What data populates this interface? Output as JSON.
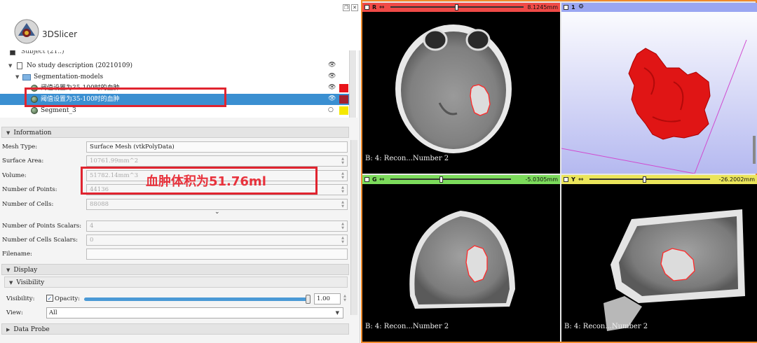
{
  "app": {
    "name": "3DSlicer"
  },
  "tree": {
    "cut_top_label": "Subject (21..)",
    "study": "No study description (20210109)",
    "folder": "Segmentation-models",
    "items": [
      {
        "label": "阈值设置为35-100时的血肿",
        "color": "#e8141a"
      },
      {
        "label": "阈值设置为35-100时的血肿",
        "color": "#a3222f",
        "selected": true
      },
      {
        "label": "Segment_3",
        "color": "#f5e800"
      }
    ]
  },
  "sections": {
    "information": "Information",
    "display": "Display",
    "visibility": "Visibility",
    "data_probe": "Data Probe"
  },
  "info": {
    "mesh_type_label": "Mesh Type:",
    "mesh_type": "Surface Mesh (vtkPolyData)",
    "surface_area_label": "Surface Area:",
    "surface_area": "10761.99mm^2",
    "volume_label": "Volume:",
    "volume": "51782.14mm^3",
    "points_label": "Number of Points:",
    "points": "44136",
    "cells_label": "Number of Cells:",
    "cells": "88088",
    "point_scalars_label": "Number of Points Scalars:",
    "point_scalars": "4",
    "cell_scalars_label": "Number of Cells Scalars:",
    "cell_scalars": "0",
    "filename_label": "Filename:",
    "filename": "",
    "more_glyph": "⌄"
  },
  "annotation": {
    "volume_note": "血肿体积为51.76ml",
    "color": "#e8323c"
  },
  "visibility": {
    "visibility_label": "Visibility:",
    "opacity_label": "Opacity:",
    "opacity_value": "1.00",
    "opacity_fraction": 1.0,
    "view_label": "View:",
    "view_value": "All"
  },
  "views": {
    "red": {
      "letter": "R",
      "value": "8.1245mm",
      "color": "#f04a47",
      "slider": 0.5,
      "label": "B: 4: Recon...Number 2"
    },
    "three_d": {
      "letter": "1",
      "color": "#9aa6f2"
    },
    "green": {
      "letter": "G",
      "value": "-5.0305mm",
      "color": "#7cdb5b",
      "slider": 0.4,
      "label": "B: 4: Recon...Number 2"
    },
    "yellow": {
      "letter": "Y",
      "value": "-26.2002mm",
      "color": "#ebe55a",
      "slider": 0.45,
      "label": "B: 4: Recon...Number 2"
    }
  }
}
